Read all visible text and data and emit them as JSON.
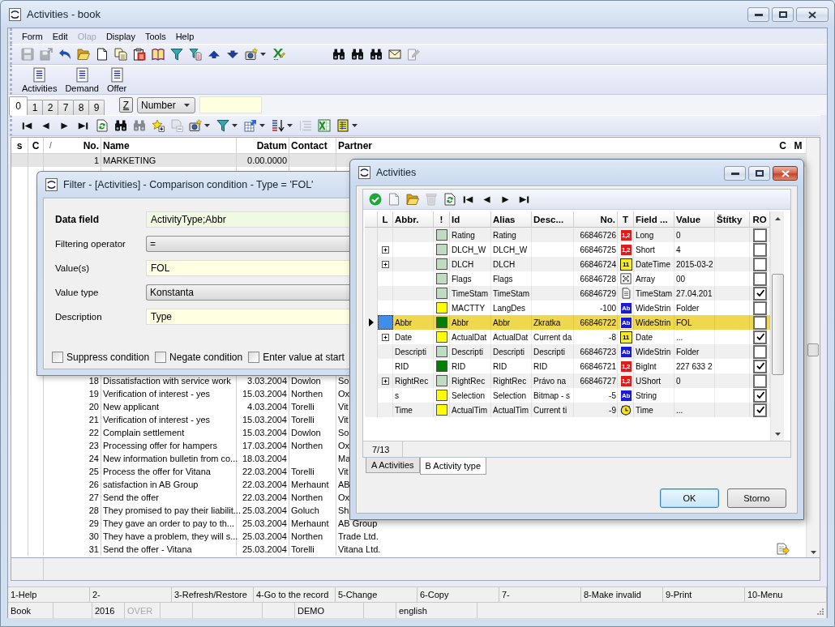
{
  "window": {
    "title": "Activities - book",
    "active": false
  },
  "menu": [
    {
      "label": "Form",
      "disabled": false
    },
    {
      "label": "Edit",
      "disabled": false
    },
    {
      "label": "Olap",
      "disabled": true
    },
    {
      "label": "Display",
      "disabled": false
    },
    {
      "label": "Tools",
      "disabled": false
    },
    {
      "label": "Help",
      "disabled": false
    }
  ],
  "toolbar_main": [
    {
      "kind": "save",
      "disabled": true,
      "dropdown": false
    },
    {
      "kind": "save_as",
      "disabled": true,
      "dropdown": false
    },
    {
      "kind": "undo",
      "disabled": false,
      "dropdown": false
    },
    {
      "kind": "open",
      "disabled": false,
      "dropdown": false
    },
    {
      "kind": "new",
      "disabled": false,
      "dropdown": false
    },
    {
      "kind": "copy",
      "disabled": false,
      "dropdown": false
    },
    {
      "kind": "clipboard",
      "disabled": false,
      "dropdown": false
    },
    {
      "kind": "book",
      "disabled": false,
      "dropdown": false
    },
    {
      "kind": "filter",
      "disabled": false,
      "dropdown": false
    },
    {
      "kind": "filter_doc",
      "disabled": false,
      "dropdown": false
    },
    {
      "kind": "up",
      "disabled": false,
      "dropdown": false
    },
    {
      "kind": "down",
      "disabled": false,
      "dropdown": false
    },
    {
      "kind": "camera",
      "disabled": false,
      "dropdown": true
    },
    {
      "kind": "excel_pen",
      "disabled": false,
      "dropdown": false
    }
  ],
  "toolbar_search": [
    {
      "kind": "binoculars",
      "disabled": false,
      "dropdown": false
    },
    {
      "kind": "binoculars",
      "disabled": false,
      "dropdown": false
    },
    {
      "kind": "binoculars",
      "disabled": false,
      "dropdown": false
    },
    {
      "kind": "envelope",
      "disabled": false,
      "dropdown": false
    },
    {
      "kind": "edit",
      "disabled": true,
      "dropdown": false
    }
  ],
  "large_buttons": [
    "Activities",
    "Demand",
    "Offer"
  ],
  "tabs": [
    {
      "label": "0",
      "selected": true
    },
    {
      "label": "1",
      "selected": false
    },
    {
      "label": "2",
      "selected": false
    },
    {
      "label": "7",
      "selected": false
    },
    {
      "label": "8",
      "selected": false
    },
    {
      "label": "9",
      "selected": false
    }
  ],
  "sort_button": {
    "label": "Z"
  },
  "sort_field": {
    "value": "Number"
  },
  "nav_toolbar": [
    {
      "kind": "first",
      "disabled": false,
      "dropdown": false
    },
    {
      "kind": "prev",
      "disabled": false,
      "dropdown": false
    },
    {
      "kind": "next",
      "disabled": false,
      "dropdown": false
    },
    {
      "kind": "last",
      "disabled": false,
      "dropdown": false
    },
    {
      "kind": "refresh",
      "disabled": false,
      "dropdown": false
    },
    {
      "kind": "binoculars",
      "disabled": false,
      "dropdown": false
    },
    {
      "kind": "binoculars",
      "disabled": true,
      "dropdown": false
    },
    {
      "kind": "star_add",
      "disabled": false,
      "dropdown": false
    },
    {
      "kind": "remove",
      "disabled": true,
      "dropdown": false
    },
    {
      "kind": "camera",
      "disabled": false,
      "dropdown": true
    },
    {
      "kind": "filter",
      "disabled": false,
      "dropdown": true
    },
    {
      "kind": "export",
      "disabled": false,
      "dropdown": true
    },
    {
      "kind": "sort",
      "disabled": false,
      "dropdown": true
    },
    {
      "kind": "indent",
      "disabled": true,
      "dropdown": false
    },
    {
      "kind": "spreadsheet",
      "disabled": false,
      "dropdown": false
    },
    {
      "kind": "columns",
      "disabled": false,
      "dropdown": true
    }
  ],
  "grid": {
    "columns": [
      "s",
      "C",
      "/",
      "No.",
      "Name",
      "Datum",
      "Contact",
      "Partner",
      "C",
      "M"
    ],
    "rows": [
      {
        "no": "1",
        "name": "MARKETING",
        "date": "0.00.0000",
        "selected": true,
        "c_icon": false
      },
      {
        "no": "18",
        "name": "Dissatisfaction with service work",
        "date": "3.03.2004",
        "contact": "Dowlon",
        "partner": "So",
        "selected": false,
        "c_icon": false
      },
      {
        "no": "19",
        "name": "Verification of interest - yes",
        "date": "15.03.2004",
        "contact": "Northen",
        "partner": "Ox",
        "selected": false,
        "c_icon": false
      },
      {
        "no": "20",
        "name": "New applicant",
        "date": "4.03.2004",
        "contact": "Torelli",
        "partner": "Vit",
        "selected": false,
        "c_icon": false
      },
      {
        "no": "21",
        "name": "Verification of interest - yes",
        "date": "15.03.2004",
        "contact": "Torelli",
        "partner": "Vit",
        "selected": false,
        "c_icon": false
      },
      {
        "no": "22",
        "name": "Complain settlement",
        "date": "15.03.2004",
        "contact": "Dowlon",
        "partner": "So",
        "selected": false,
        "c_icon": false
      },
      {
        "no": "23",
        "name": "Processing offer for hampers",
        "date": "17.03.2004",
        "contact": "Northen",
        "partner": "Ox",
        "selected": false,
        "c_icon": false
      },
      {
        "no": "24",
        "name": "New information bulletin from co...",
        "date": "18.03.2004",
        "partner": "Ma",
        "selected": false,
        "c_icon": false
      },
      {
        "no": "25",
        "name": "Process the offer for Vitana",
        "date": "22.03.2004",
        "contact": "Torelli",
        "partner": "Vit",
        "selected": false,
        "c_icon": false
      },
      {
        "no": "26",
        "name": "satisfaction in AB Group",
        "date": "22.03.2004",
        "contact": "Merhaunt",
        "partner": "AB",
        "selected": false,
        "c_icon": false
      },
      {
        "no": "27",
        "name": "Send the offer",
        "date": "22.03.2004",
        "contact": "Northen",
        "partner": "Ox",
        "selected": false,
        "c_icon": false
      },
      {
        "no": "28",
        "name": "They promised to pay their liabilit...",
        "date": "25.03.2004",
        "contact": "Goluch",
        "partner": "Sh",
        "selected": false,
        "c_icon": false
      },
      {
        "no": "29",
        "name": "They gave an order to pay to th...",
        "date": "25.03.2004",
        "contact": "Merhaunt",
        "partner": "AB Group",
        "selected": false,
        "c_icon": false
      },
      {
        "no": "30",
        "name": "They have a problem, they will s...",
        "date": "25.03.2004",
        "contact": "Northen",
        "partner": "Trade Ltd.",
        "selected": false,
        "c_icon": false
      },
      {
        "no": "31",
        "name": "Send the offer - Vitana",
        "date": "25.03.2004",
        "contact": "Torelli",
        "partner": "Vitana Ltd.",
        "selected": false,
        "c_icon": true
      }
    ]
  },
  "function_keys": [
    "1-Help",
    "2-",
    "3-Refresh/Restore",
    "4-Go to the record",
    "5-Change",
    "6-Copy",
    "7-",
    "8-Make invalid",
    "9-Print",
    "10-Menu"
  ],
  "status_bar": [
    {
      "text": "Book",
      "disabled": false
    },
    {
      "text": "2016",
      "disabled": false
    },
    {
      "text": "OVER",
      "disabled": true
    },
    {
      "text": "DEMO",
      "disabled": false
    },
    {
      "text": "english",
      "disabled": false
    }
  ],
  "filter_dialog": {
    "title": "Filter - [Activities] - Comparison condition - Type = 'FOL'",
    "fields": [
      {
        "label": "Data field",
        "kind": "display",
        "value": "ActivityType;Abbr",
        "emphasized": true
      },
      {
        "label": "Filtering operator",
        "kind": "dropdown",
        "value": "=",
        "emphasized": false
      },
      {
        "label": "Value(s)",
        "kind": "text",
        "value": "FOL",
        "emphasized": false
      },
      {
        "label": "Value type",
        "kind": "dropdown",
        "value": "Konstanta",
        "emphasized": false
      },
      {
        "label": "Description",
        "kind": "text",
        "value": "Type",
        "emphasized": false
      }
    ],
    "options": [
      {
        "label": "Suppress condition",
        "checked": false
      },
      {
        "label": "Negate condition",
        "checked": false
      },
      {
        "label": "Enter value at start",
        "checked": false
      }
    ]
  },
  "activities_dialog": {
    "title": "Activities",
    "active": true,
    "toolbar": [
      {
        "kind": "check",
        "disabled": false,
        "dropdown": false
      },
      {
        "kind": "new",
        "disabled": true,
        "dropdown": false
      },
      {
        "kind": "open",
        "disabled": false,
        "dropdown": false
      },
      {
        "kind": "delete",
        "disabled": true,
        "dropdown": false
      },
      {
        "kind": "refresh",
        "disabled": false,
        "dropdown": false
      },
      {
        "kind": "first",
        "disabled": false,
        "dropdown": false
      },
      {
        "kind": "prev",
        "disabled": false,
        "dropdown": false
      },
      {
        "kind": "next",
        "disabled": false,
        "dropdown": false
      },
      {
        "kind": "last",
        "disabled": false,
        "dropdown": false
      }
    ],
    "columns": [
      "L",
      "Abbr.",
      "!",
      "Id",
      "Alias",
      "Desc...",
      "No.",
      "T",
      "Field ...",
      "Value",
      "Štítky",
      "RO"
    ],
    "rows": [
      {
        "selected": false,
        "expandable": false,
        "color": "#c0dcc0",
        "id": "Rating",
        "alias": "Rating",
        "no": "66846726",
        "kind": "number",
        "type_badge": "1,2",
        "field_type": "Long",
        "value": "0",
        "ro": false
      },
      {
        "selected": false,
        "expandable": true,
        "color": "#c0dcc0",
        "id": "DLCH_W",
        "alias": "DLCH_W",
        "no": "66846725",
        "kind": "number",
        "type_badge": "1,2",
        "field_type": "Short",
        "value": "4",
        "ro": false
      },
      {
        "selected": false,
        "expandable": true,
        "color": "#c0dcc0",
        "id": "DLCH",
        "alias": "DLCH",
        "no": "66846724",
        "kind": "date",
        "type_badge": "11",
        "field_type": "DateTime",
        "value": "2015-03-2",
        "ro": false
      },
      {
        "selected": false,
        "expandable": false,
        "color": "#c0dcc0",
        "id": "Flags",
        "alias": "Flags",
        "no": "66846728",
        "kind": "array",
        "field_type": "Array",
        "value": "00",
        "ro": false
      },
      {
        "selected": false,
        "expandable": false,
        "color": "#c0dcc0",
        "id": "TimeStam",
        "alias": "TimeStam",
        "no": "66846729",
        "kind": "memo",
        "field_type": "TimeStam",
        "value": "27.04.201",
        "ro": true
      },
      {
        "selected": false,
        "expandable": false,
        "color": "#ffff00",
        "id": "MACTTY",
        "alias": "LangDes",
        "no": "-100",
        "kind": "string",
        "type_badge": "Ab",
        "field_type": "WideStrin",
        "value": "Folder",
        "ro": false
      },
      {
        "selected": true,
        "expandable": false,
        "abbr": "Abbr",
        "color": "#008000",
        "id": "Abbr",
        "alias": "Abbr",
        "description": "Zkratka",
        "no": "66846722",
        "kind": "string",
        "type_badge": "Ab",
        "field_type": "WideStrin",
        "value": "FOL",
        "ro": false
      },
      {
        "selected": false,
        "expandable": true,
        "abbr": "Date",
        "color": "#ffff00",
        "id": "ActualDat",
        "alias": "ActualDat",
        "description": "Current da",
        "no": "-8",
        "kind": "date",
        "type_badge": "11",
        "field_type": "Date",
        "value": "...",
        "ro": true
      },
      {
        "selected": false,
        "expandable": false,
        "abbr": "Descripti",
        "color": "#c0dcc0",
        "id": "Descripti",
        "alias": "Descripti",
        "description": "Descripti",
        "no": "66846723",
        "kind": "string",
        "type_badge": "Ab",
        "field_type": "WideStrin",
        "value": "Folder",
        "ro": false
      },
      {
        "selected": false,
        "expandable": false,
        "abbr": "RID",
        "color": "#008000",
        "id": "RID",
        "alias": "RID",
        "description": "RID",
        "no": "66846721",
        "kind": "number",
        "type_badge": "1,2",
        "field_type": "BigInt",
        "value": "227 633 2",
        "ro": true
      },
      {
        "selected": false,
        "expandable": true,
        "abbr": "RightRec",
        "color": "#c0dcc0",
        "id": "RightRec",
        "alias": "RightRec",
        "description": "Právo na",
        "no": "66846727",
        "kind": "number",
        "type_badge": "1,2",
        "field_type": "UShort",
        "value": "0",
        "ro": false
      },
      {
        "selected": false,
        "expandable": false,
        "abbr": "s",
        "color": "#ffff00",
        "id": "Selection",
        "alias": "Selection",
        "description": "Bitmap - s",
        "no": "-5",
        "kind": "string",
        "type_badge": "Ab",
        "field_type": "String",
        "ro": true
      },
      {
        "selected": false,
        "expandable": false,
        "abbr": "Time",
        "color": "#ffff00",
        "id": "ActualTim",
        "alias": "ActualTim",
        "description": "Current ti",
        "no": "-9",
        "kind": "time",
        "field_type": "Time",
        "value": "...",
        "ro": true
      }
    ],
    "counter": "7/13",
    "tabs": [
      {
        "label": "A Activities",
        "selected": false
      },
      {
        "label": "B Activity type",
        "selected": true
      }
    ],
    "buttons": [
      {
        "label": "OK",
        "default": true
      },
      {
        "label": "Storno",
        "default": false
      }
    ]
  }
}
